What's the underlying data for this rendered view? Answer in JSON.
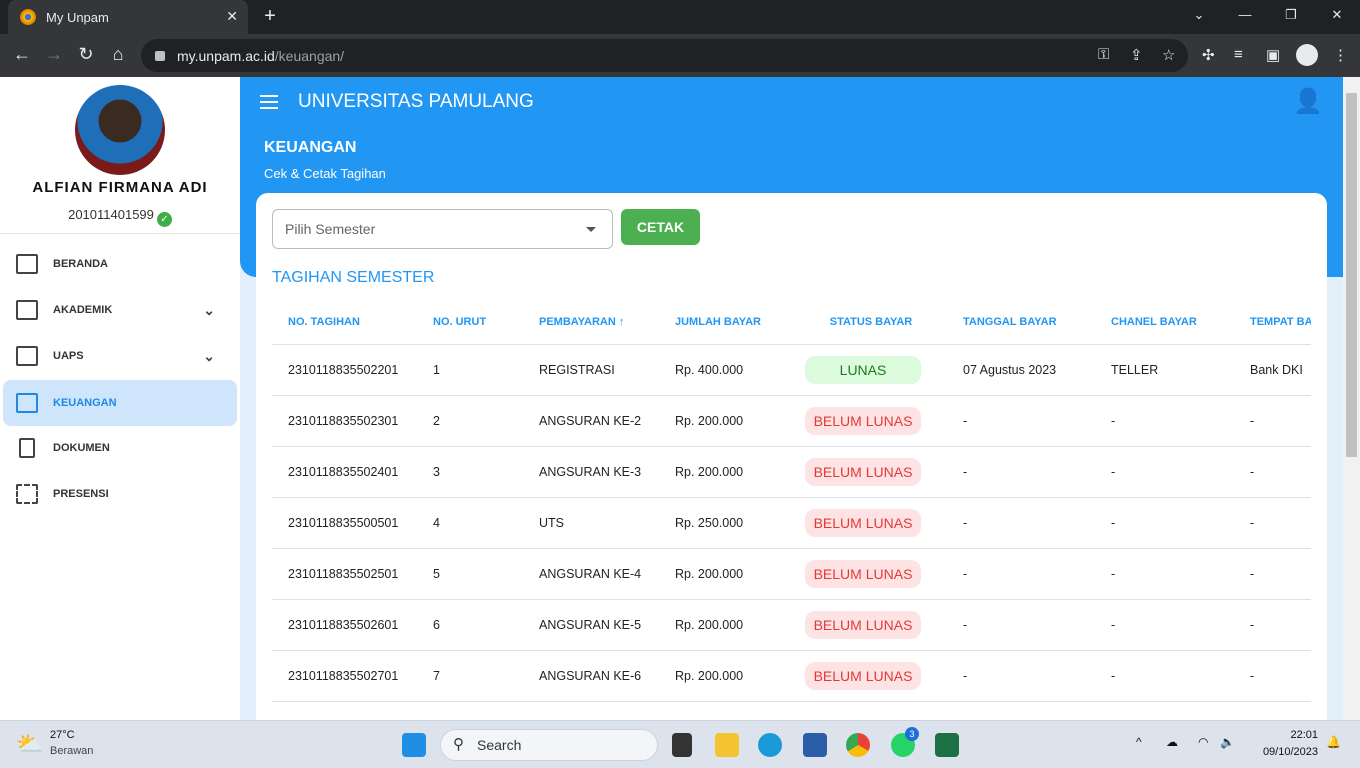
{
  "browser": {
    "tab_title": "My Unpam",
    "url_host": "my.unpam.ac.id",
    "url_path": "/keuangan/"
  },
  "sidebar": {
    "user_name": "ALFIAN FIRMANA ADI",
    "nim": "201011401599",
    "items": [
      {
        "label": "BERANDA",
        "icon": "dashboard-icon"
      },
      {
        "label": "AKADEMIK",
        "icon": "graduation-cap-icon",
        "expandable": true
      },
      {
        "label": "UAPS",
        "icon": "book-open-icon",
        "expandable": true
      },
      {
        "label": "KEUANGAN",
        "icon": "bank-icon",
        "active": true
      },
      {
        "label": "DOKUMEN",
        "icon": "document-icon"
      },
      {
        "label": "PRESENSI",
        "icon": "qr-code-icon"
      }
    ]
  },
  "header": {
    "brand": "UNIVERSITAS PAMULANG",
    "page_title": "KEUANGAN",
    "page_subtitle": "Cek & Cetak Tagihan"
  },
  "form": {
    "semester_placeholder": "Pilih Semester",
    "print_label": "CETAK"
  },
  "table": {
    "title": "TAGIHAN SEMESTER",
    "columns": [
      "NO. TAGIHAN",
      "NO. URUT",
      "PEMBAYARAN ↑",
      "JUMLAH BAYAR",
      "STATUS BAYAR",
      "TANGGAL BAYAR",
      "CHANEL BAYAR",
      "TEMPAT BAYAR"
    ],
    "rows": [
      [
        "2310118835502201",
        "1",
        "REGISTRASI",
        "Rp. 400.000",
        "LUNAS",
        "07 Agustus 2023",
        "TELLER",
        "Bank DKI"
      ],
      [
        "2310118835502301",
        "2",
        "ANGSURAN KE-2",
        "Rp. 200.000",
        "BELUM LUNAS",
        "-",
        "-",
        "-"
      ],
      [
        "2310118835502401",
        "3",
        "ANGSURAN KE-3",
        "Rp. 200.000",
        "BELUM LUNAS",
        "-",
        "-",
        "-"
      ],
      [
        "2310118835500501",
        "4",
        "UTS",
        "Rp. 250.000",
        "BELUM LUNAS",
        "-",
        "-",
        "-"
      ],
      [
        "2310118835502501",
        "5",
        "ANGSURAN KE-4",
        "Rp. 200.000",
        "BELUM LUNAS",
        "-",
        "-",
        "-"
      ],
      [
        "2310118835502601",
        "6",
        "ANGSURAN KE-5",
        "Rp. 200.000",
        "BELUM LUNAS",
        "-",
        "-",
        "-"
      ],
      [
        "2310118835502701",
        "7",
        "ANGSURAN KE-6",
        "Rp. 200.000",
        "BELUM LUNAS",
        "-",
        "-",
        "-"
      ]
    ]
  },
  "colors": {
    "primary": "#2196f3",
    "success": "#4caf50",
    "lunas_bg": "#dcfadc",
    "lunas_fg": "#1b7a1b",
    "belum_bg": "#fde3e3",
    "belum_fg": "#e53935"
  },
  "taskbar": {
    "temp": "27°C",
    "weather": "Berawan",
    "search": "Search",
    "whatsapp_badge": "3",
    "time": "22:01",
    "date": "09/10/2023"
  }
}
